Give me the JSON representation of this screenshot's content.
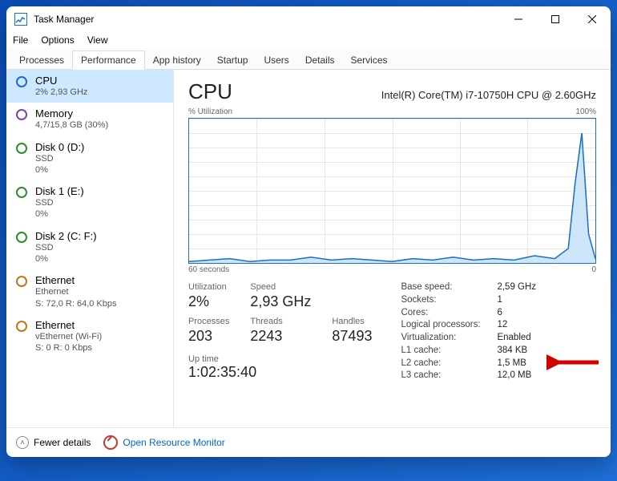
{
  "window": {
    "title": "Task Manager",
    "menu": {
      "file": "File",
      "options": "Options",
      "view": "View"
    },
    "buttons": {
      "min": "—",
      "max": "▢",
      "close": "✕"
    }
  },
  "tabs": {
    "processes": "Processes",
    "performance": "Performance",
    "app_history": "App history",
    "startup": "Startup",
    "users": "Users",
    "details": "Details",
    "services": "Services"
  },
  "sidebar": [
    {
      "id": "cpu",
      "title": "CPU",
      "sub": "2% 2,93 GHz",
      "dot": "cpu",
      "selected": true
    },
    {
      "id": "memory",
      "title": "Memory",
      "sub": "4,7/15,8 GB (30%)",
      "dot": "mem"
    },
    {
      "id": "disk0",
      "title": "Disk 0 (D:)",
      "sub": "SSD\n0%",
      "dot": "disk"
    },
    {
      "id": "disk1",
      "title": "Disk 1 (E:)",
      "sub": "SSD\n0%",
      "dot": "disk"
    },
    {
      "id": "disk2",
      "title": "Disk 2 (C: F:)",
      "sub": "SSD\n0%",
      "dot": "disk"
    },
    {
      "id": "eth0",
      "title": "Ethernet",
      "sub": "Ethernet\nS: 72,0 R: 64,0 Kbps",
      "dot": "eth"
    },
    {
      "id": "eth1",
      "title": "Ethernet",
      "sub": "vEthernet (Wi-Fi)\nS: 0 R: 0 Kbps",
      "dot": "eth"
    }
  ],
  "main": {
    "title": "CPU",
    "cpu_name": "Intel(R) Core(TM) i7-10750H CPU @ 2.60GHz",
    "chart_top_left": "% Utilization",
    "chart_top_right": "100%",
    "chart_bottom_left": "60 seconds",
    "chart_bottom_right": "0",
    "stats_left": {
      "utilization_label": "Utilization",
      "utilization": "2%",
      "speed_label": "Speed",
      "speed": "2,93 GHz",
      "processes_label": "Processes",
      "processes": "203",
      "threads_label": "Threads",
      "threads": "2243",
      "handles_label": "Handles",
      "handles": "87493",
      "uptime_label": "Up time",
      "uptime": "1:02:35:40"
    },
    "stats_right": {
      "base_speed_label": "Base speed:",
      "base_speed": "2,59 GHz",
      "sockets_label": "Sockets:",
      "sockets": "1",
      "cores_label": "Cores:",
      "cores": "6",
      "logical_label": "Logical processors:",
      "logical": "12",
      "virt_label": "Virtualization:",
      "virt": "Enabled",
      "l1_label": "L1 cache:",
      "l1": "384 KB",
      "l2_label": "L2 cache:",
      "l2": "1,5 MB",
      "l3_label": "L3 cache:",
      "l3": "12,0 MB"
    }
  },
  "footer": {
    "fewer": "Fewer details",
    "resource_monitor": "Open Resource Monitor"
  },
  "chart_data": {
    "type": "line",
    "title": "% Utilization",
    "xlabel": "seconds",
    "ylabel": "% Utilization",
    "ylim": [
      0,
      100
    ],
    "xlim": [
      60,
      0
    ],
    "x": [
      60,
      57,
      54,
      51,
      48,
      45,
      42,
      39,
      36,
      33,
      30,
      27,
      24,
      21,
      18,
      15,
      12,
      9,
      6,
      4,
      3,
      2,
      1,
      0
    ],
    "values": [
      1,
      2,
      3,
      1,
      2,
      2,
      4,
      2,
      3,
      2,
      1,
      3,
      2,
      4,
      2,
      3,
      2,
      5,
      3,
      10,
      55,
      90,
      20,
      3
    ]
  }
}
